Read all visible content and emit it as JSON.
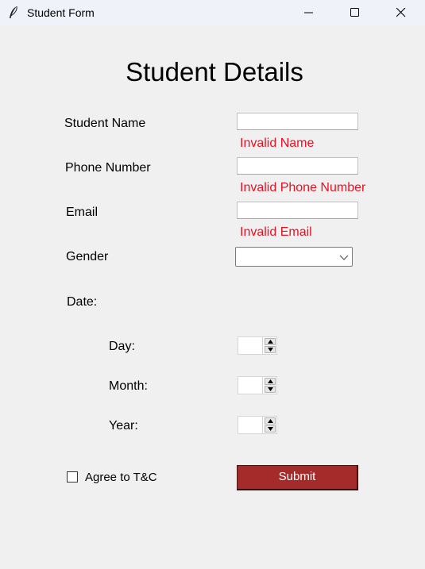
{
  "window": {
    "title": "Student Form",
    "icon": "feather-icon",
    "controls": [
      "minimize-icon",
      "maximize-icon",
      "close-icon"
    ]
  },
  "form": {
    "heading": "Student Details",
    "student_name": {
      "label": "Student Name",
      "value": "",
      "error": "Invalid Name"
    },
    "phone_number": {
      "label": "Phone Number",
      "value": "",
      "error": "Invalid Phone Number"
    },
    "email": {
      "label": "Email",
      "value": "",
      "error": "Invalid Email"
    },
    "gender": {
      "label": "Gender",
      "value": ""
    },
    "date": {
      "label": "Date:",
      "day": {
        "label": "Day:",
        "value": ""
      },
      "month": {
        "label": "Month:",
        "value": ""
      },
      "year": {
        "label": "Year:",
        "value": ""
      }
    },
    "agree": {
      "label": "Agree to T&C",
      "checked": false
    },
    "submit_label": "Submit"
  },
  "colors": {
    "error_text": "#e81123",
    "submit_bg": "#a52a2a",
    "window_bg": "#f0f0f0",
    "titlebar_bg": "#eff2f9"
  }
}
